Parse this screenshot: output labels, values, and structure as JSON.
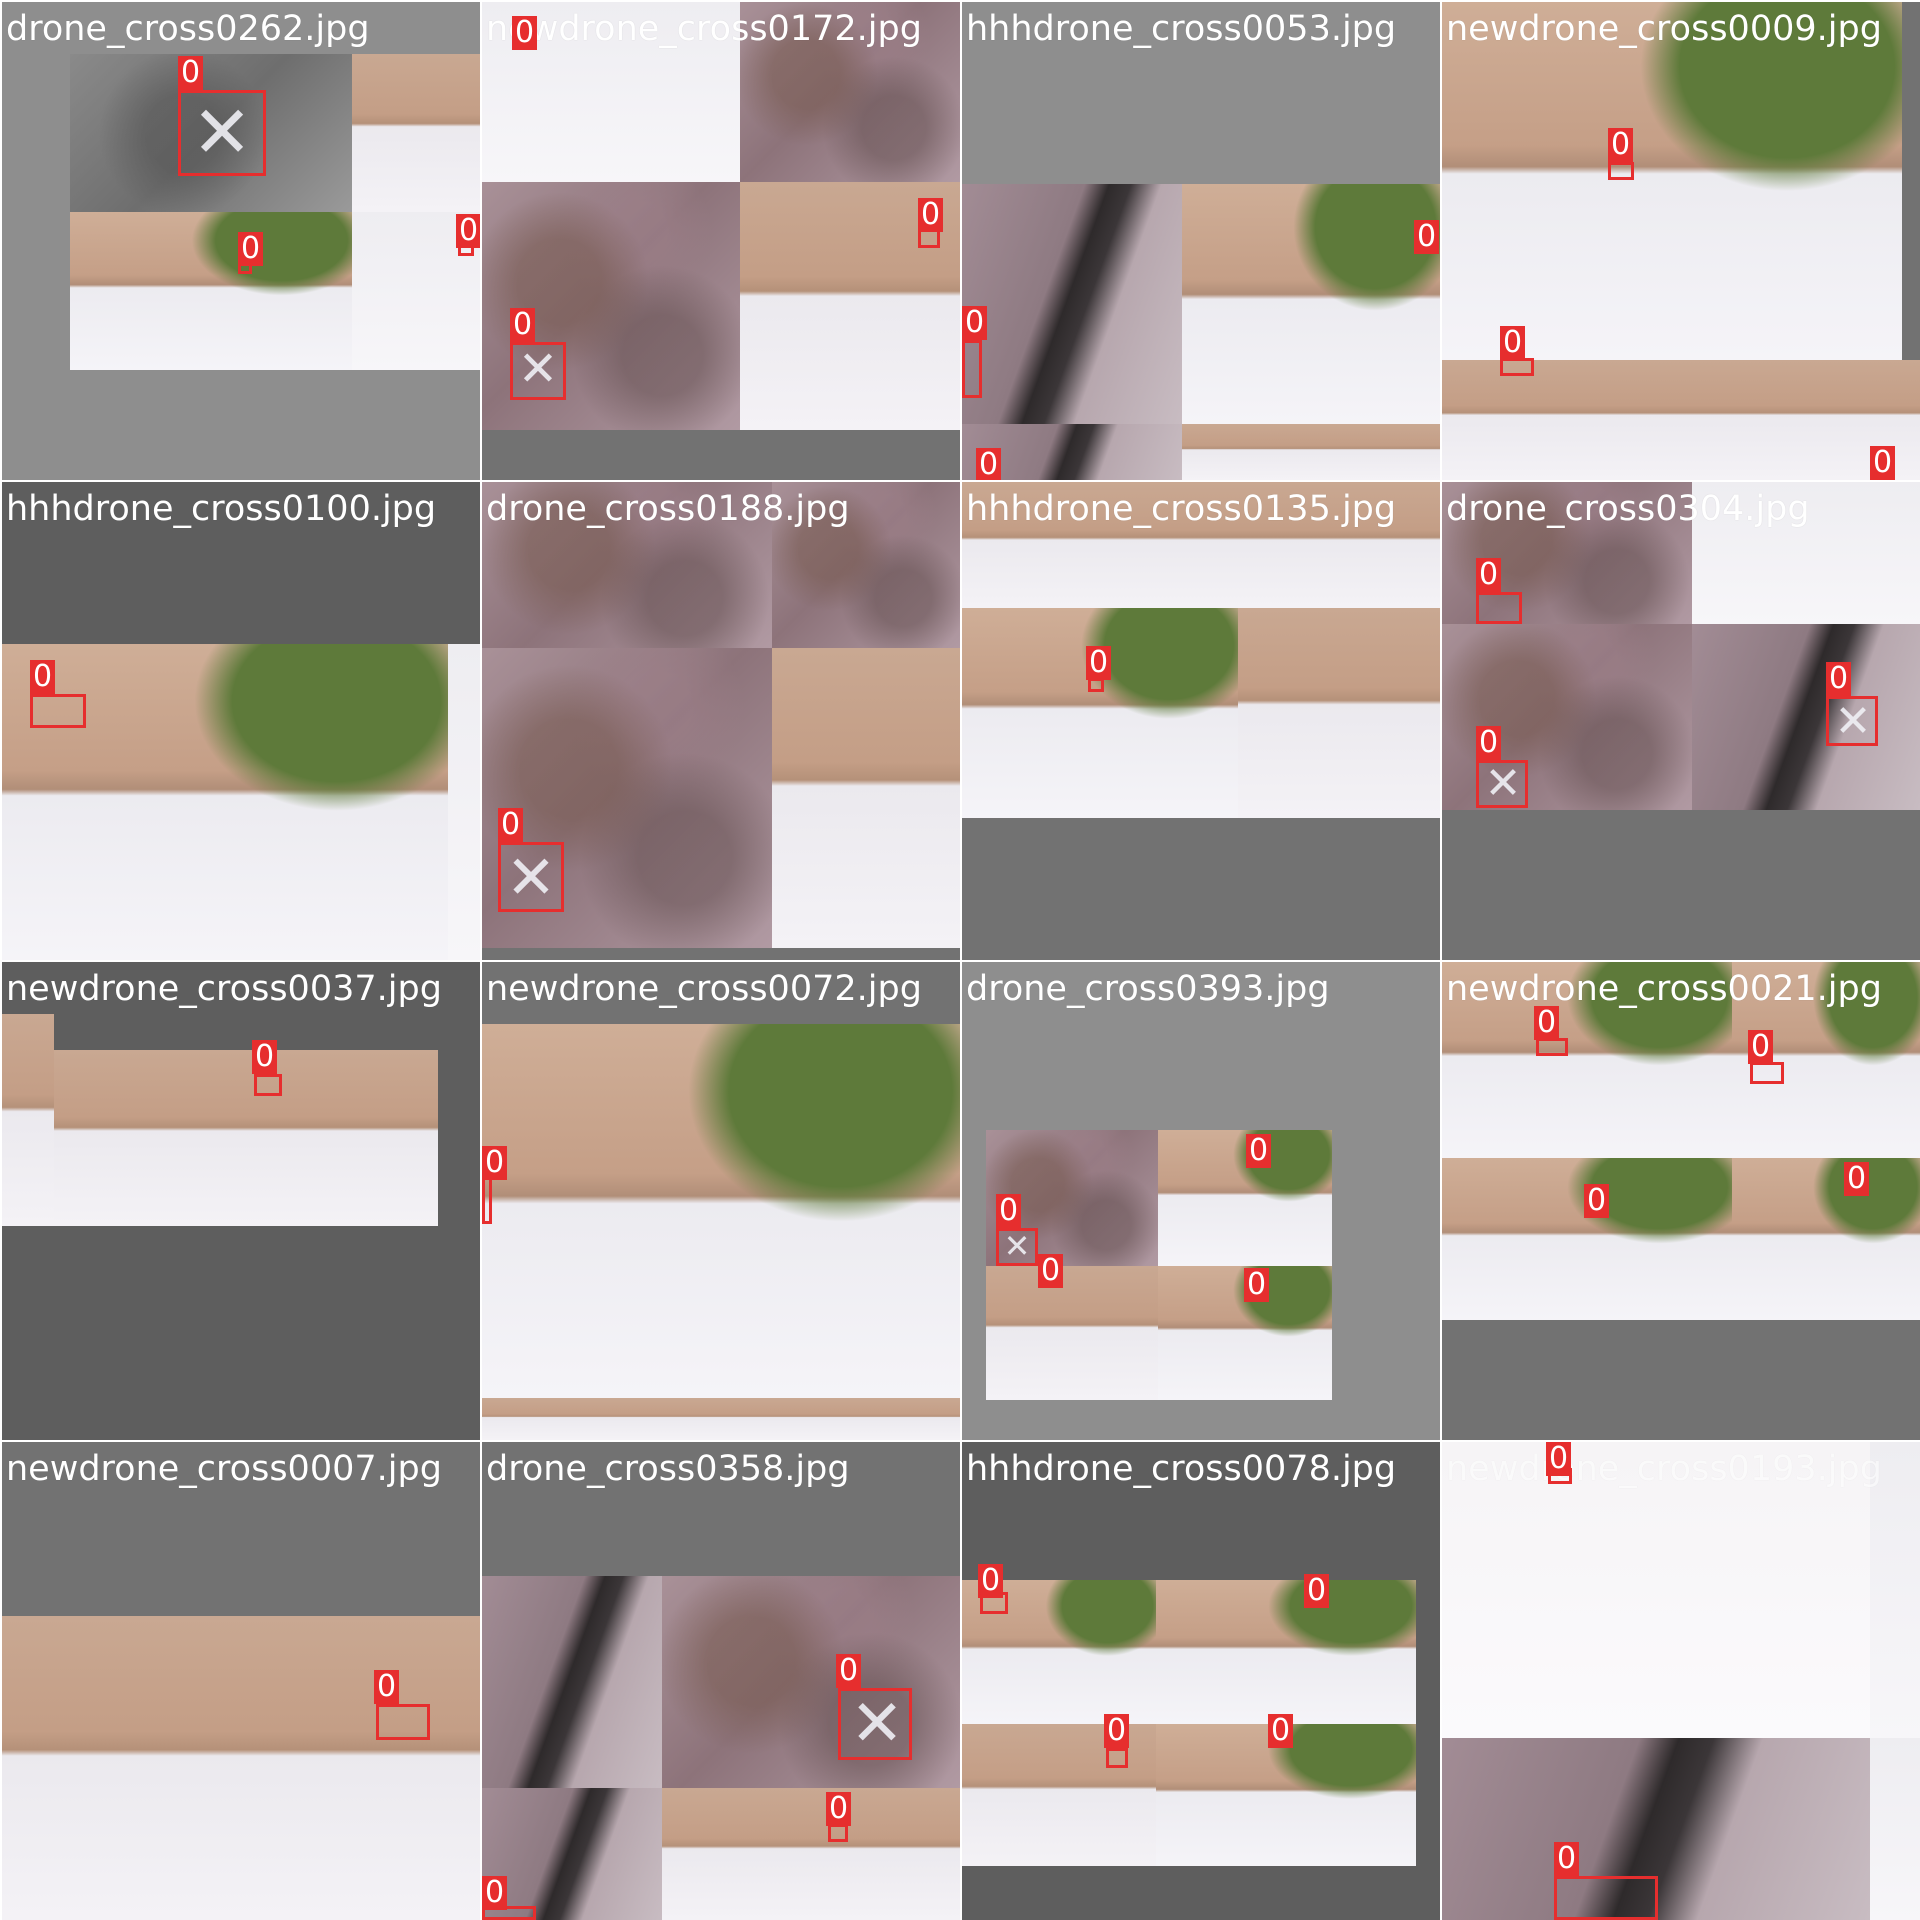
{
  "grid": {
    "label_color": "#e62e2e",
    "tiles": [
      {
        "filename": "drone_cross0262.jpg",
        "labels": [
          "0",
          "0",
          "0"
        ]
      },
      {
        "filename": "newdrone_cross0172.jpg",
        "labels": [
          "0",
          "0",
          "0"
        ]
      },
      {
        "filename": "hhhdrone_cross0053.jpg",
        "labels": [
          "0",
          "0",
          "0"
        ]
      },
      {
        "filename": "newdrone_cross0009.jpg",
        "labels": [
          "0",
          "0",
          "0"
        ]
      },
      {
        "filename": "hhhdrone_cross0100.jpg",
        "labels": [
          "0"
        ]
      },
      {
        "filename": "drone_cross0188.jpg",
        "labels": [
          "0"
        ]
      },
      {
        "filename": "hhhdrone_cross0135.jpg",
        "labels": [
          "0"
        ]
      },
      {
        "filename": "drone_cross0304.jpg",
        "labels": [
          "0",
          "0",
          "0"
        ]
      },
      {
        "filename": "newdrone_cross0037.jpg",
        "labels": [
          "0"
        ]
      },
      {
        "filename": "newdrone_cross0072.jpg",
        "labels": [
          "0"
        ]
      },
      {
        "filename": "drone_cross0393.jpg",
        "labels": [
          "0",
          "0",
          "0",
          "0"
        ]
      },
      {
        "filename": "newdrone_cross0021.jpg",
        "labels": [
          "0",
          "0",
          "0",
          "0"
        ]
      },
      {
        "filename": "newdrone_cross0007.jpg",
        "labels": [
          "0"
        ]
      },
      {
        "filename": "drone_cross0358.jpg",
        "labels": [
          "0",
          "0",
          "0"
        ]
      },
      {
        "filename": "hhhdrone_cross0078.jpg",
        "labels": [
          "0",
          "0",
          "0",
          "0"
        ]
      },
      {
        "filename": "newdrone_cross0193.jpg",
        "labels": [
          "0",
          "0"
        ]
      }
    ]
  }
}
